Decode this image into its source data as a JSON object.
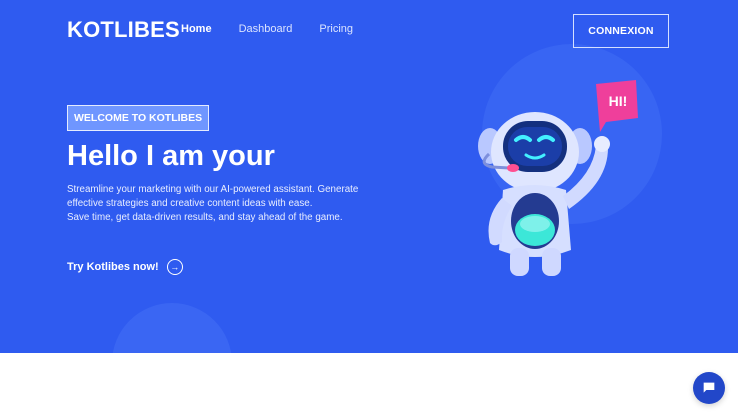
{
  "brand": {
    "name": "KOTLIBES"
  },
  "nav": {
    "items": [
      {
        "label": "Home",
        "active": true
      },
      {
        "label": "Dashboard",
        "active": false
      },
      {
        "label": "Pricing",
        "active": false
      }
    ],
    "cta_label": "CONNEXION"
  },
  "hero": {
    "badge": "WELCOME TO KOTLIBES",
    "headline": "Hello I am your",
    "description_lines": [
      "Streamline your marketing with our AI-powered assistant. Generate",
      "effective strategies and creative content ideas with ease.",
      "Save time, get data-driven results, and stay ahead of the game."
    ],
    "cta": "Try Kotlibes now!",
    "robot_sign": "HI!"
  },
  "colors": {
    "hero_bg": "#2f5bf0",
    "badge_bg": "#6f96ff",
    "chat_bg": "#2247c9"
  },
  "icons": {
    "cta_arrow": "arrow-right-circle-icon",
    "chat": "chat-icon",
    "robot": "robot-illustration"
  }
}
